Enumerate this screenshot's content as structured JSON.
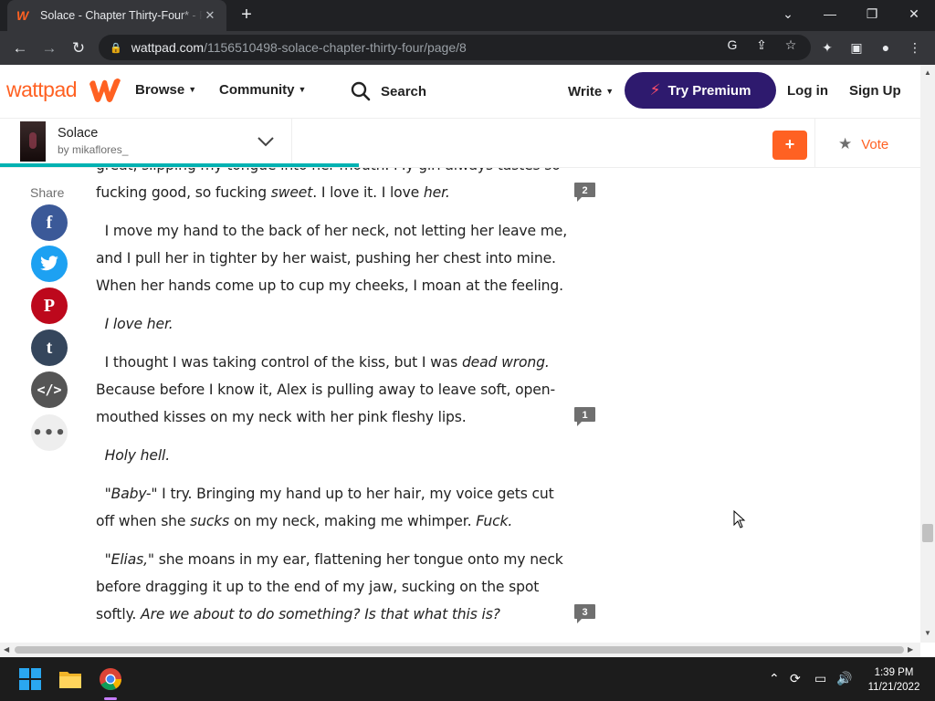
{
  "browser": {
    "tab_title": "Solace - Chapter Thirty-Four* - P",
    "new_tab": "+",
    "url_domain": "wattpad.com",
    "url_path": "/1156510498-solace-chapter-thirty-four/page/8"
  },
  "header": {
    "logo_text": "wattpad",
    "browse": "Browse",
    "community": "Community",
    "search": "Search",
    "write": "Write",
    "premium": "Try Premium",
    "login": "Log in",
    "signup": "Sign Up"
  },
  "story": {
    "title": "Solace",
    "author": "by mikaflores_",
    "add_label": "+",
    "vote": "Vote",
    "reading_progress": 0.39
  },
  "share": {
    "label": "Share",
    "networks": [
      "facebook",
      "twitter",
      "pinterest",
      "tumblr",
      "embed",
      "more"
    ]
  },
  "paragraphs": [
    {
      "html": "great, slipping my tongue into her mouth. My girl always tastes so fucking good, so fucking <i>sweet</i>. I love it. I love <i>her.</i>",
      "comments": "2"
    },
    {
      "html": "&nbsp;&nbsp;I move my hand to the back of her neck, not letting her leave me, and I pull her in tighter by her waist, pushing her chest into mine. When her hands come up to cup my cheeks, I moan at the feeling.",
      "comments": ""
    },
    {
      "html": "&nbsp;&nbsp;<i>I love her.</i>",
      "comments": ""
    },
    {
      "html": "&nbsp;&nbsp;I thought I was taking control of the kiss, but I was <i>dead wrong.</i> Because before I know it, Alex is pulling away to leave soft, open-mouthed kisses on my neck with her pink fleshy lips.",
      "comments": "1"
    },
    {
      "html": "&nbsp;&nbsp;<i>Holy hell.</i>",
      "comments": ""
    },
    {
      "html": "&nbsp;&nbsp;\"<i>Baby-\"</i> I try. Bringing my hand up to her hair, my voice gets cut off when she <i>sucks</i> on my neck, making me whimper. <i>Fuck.</i>",
      "comments": ""
    },
    {
      "html": "&nbsp;&nbsp;\"<i>Elias,\"</i> she moans in my ear, flattening her tongue onto my neck before dragging it up to the end of my jaw, sucking on the spot softly. <i>Are we about to do something? Is that what this is?</i>",
      "comments": "3"
    }
  ],
  "taskbar": {
    "time": "1:39 PM",
    "date": "11/21/2022"
  },
  "colors": {
    "brand": "#ff6122",
    "premium": "#2e1a6e",
    "progress": "#00b2b2"
  }
}
